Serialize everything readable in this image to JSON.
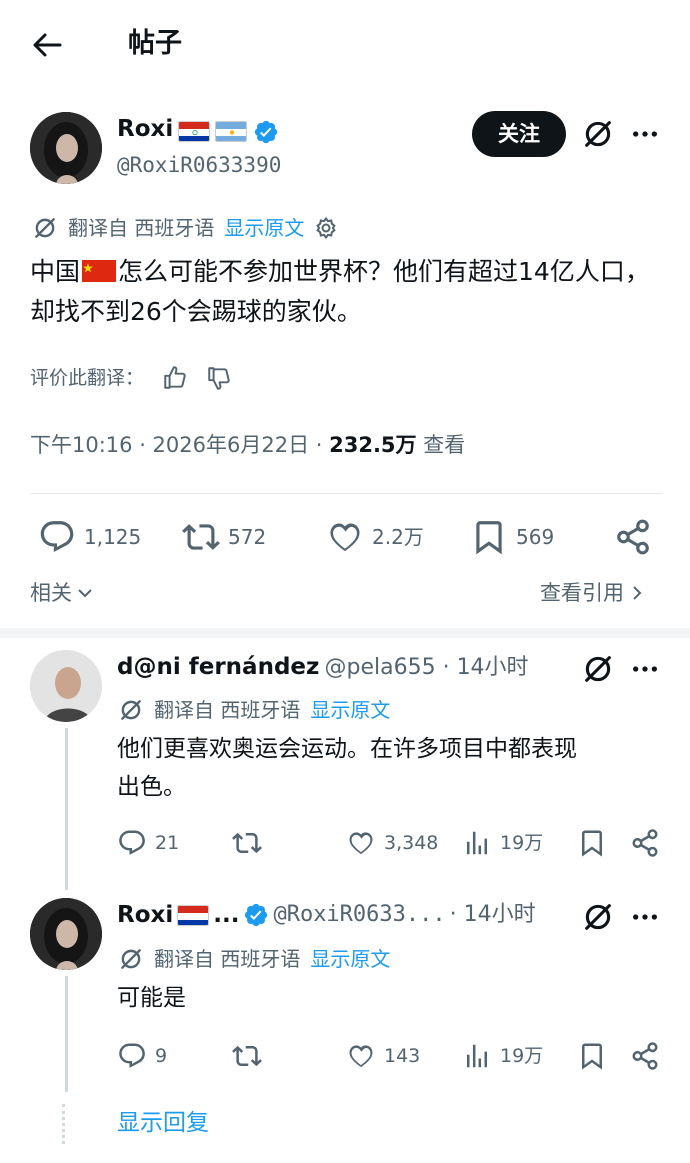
{
  "header": {
    "title": "帖子"
  },
  "post": {
    "author": {
      "name": "Roxi",
      "handle": "@RoxiR0633390"
    },
    "follow_label": "关注",
    "translation": {
      "from": "翻译自 西班牙语",
      "show_original": "显示原文"
    },
    "body_before_flag": "中国",
    "body_after_flag": "怎么可能不参加世界杯？他们有超过14亿人口，却找不到26个会踢球的家伙。",
    "rate_label": "评价此翻译：",
    "time": "下午10:16 · 2026年6月22日 · ",
    "views": "232.5万",
    "views_label": " 查看",
    "stats": {
      "replies": "1,125",
      "reposts": "572",
      "likes": "2.2万",
      "bookmarks": "569"
    },
    "related": "相关",
    "view_quotes": "查看引用"
  },
  "replies": [
    {
      "name": "d@ni fernández",
      "handle_time": "@pela655 · 14小时",
      "translation": "翻译自 西班牙语",
      "show_original": "显示原文",
      "text_line1": "他们更喜欢奥运会运动。在许多项目中都表现",
      "text_line2": "出色。",
      "stats": {
        "replies": "21",
        "likes": "3,348",
        "views": "19万"
      }
    },
    {
      "name": "Roxi",
      "name_suffix": "...",
      "handle": "@RoxiR0633...",
      "time": "· 14小时",
      "translation": "翻译自 西班牙语",
      "show_original": "显示原文",
      "text_line1": "可能是",
      "stats": {
        "replies": "9",
        "likes": "143",
        "views": "19万"
      }
    }
  ],
  "show_replies": "显示回复",
  "colors": {
    "accent": "#1d9bf0",
    "text": "#0f1419",
    "muted": "#536471"
  }
}
